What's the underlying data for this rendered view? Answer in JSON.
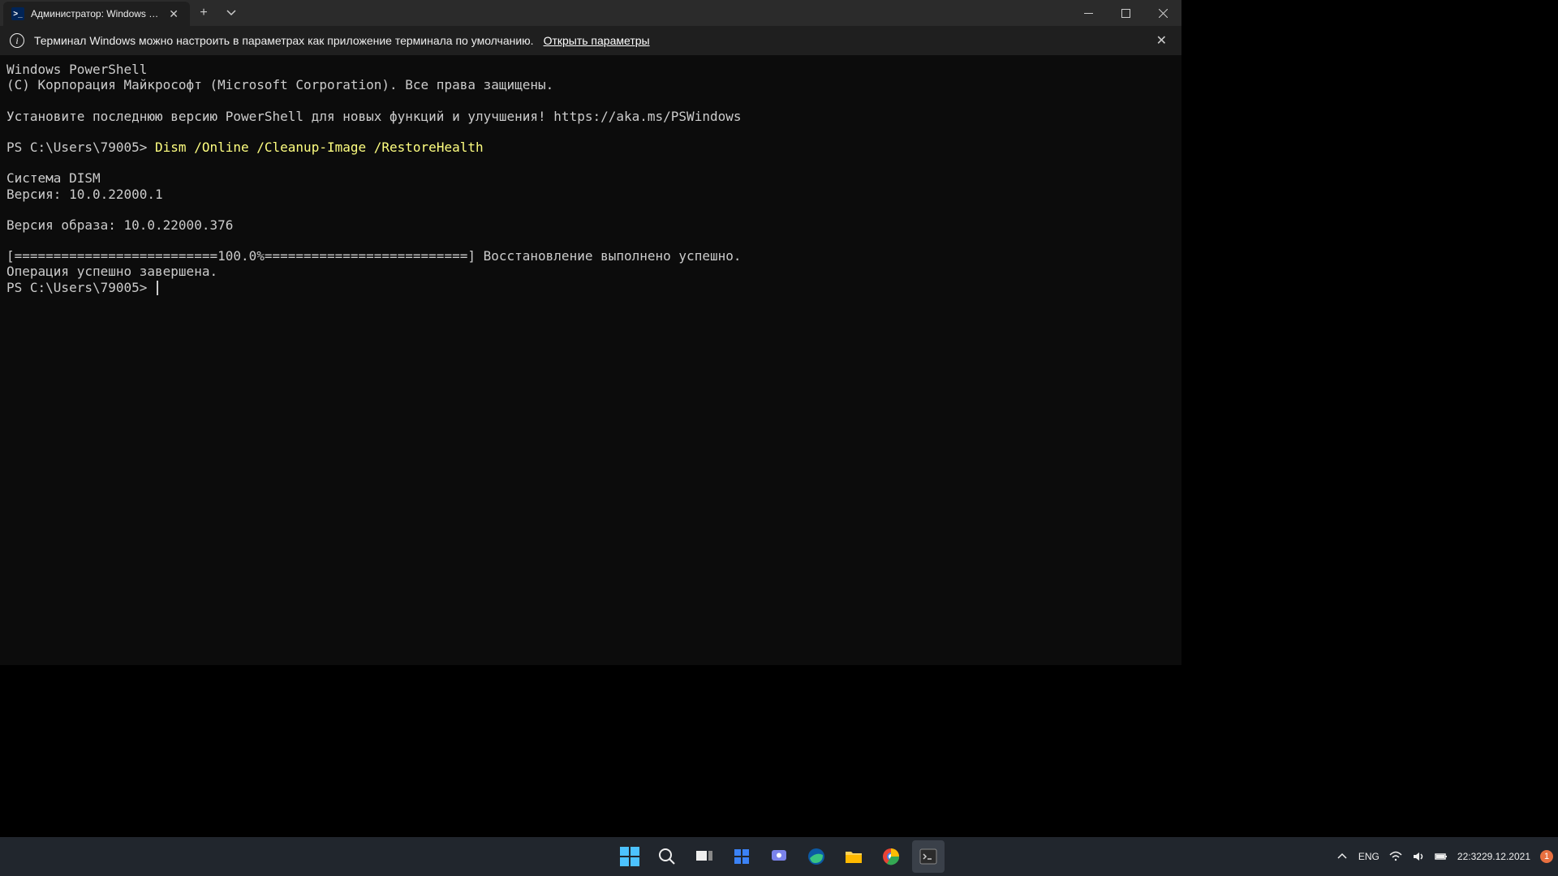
{
  "window": {
    "tab_title": "Администратор: Windows Pow",
    "tab_icon_label": ">_"
  },
  "infobar": {
    "message": "Терминал Windows можно настроить в параметрах как приложение терминала по умолчанию.",
    "link": "Открыть параметры"
  },
  "terminal": {
    "lines": [
      "Windows PowerShell",
      "(C) Корпорация Майкрософт (Microsoft Corporation). Все права защищены.",
      "",
      "Установите последнюю версию PowerShell для новых функций и улучшения! https://aka.ms/PSWindows",
      ""
    ],
    "prompt1_prefix": "PS C:\\Users\\79005> ",
    "prompt1_cmd": "Dism /Online /Cleanup-Image /RestoreHealth",
    "lines2": [
      "",
      "Cистема DISM",
      "Версия: 10.0.22000.1",
      "",
      "Версия образа: 10.0.22000.376",
      "",
      "[==========================100.0%==========================] Восстановление выполнено успешно.",
      "Операция успешно завершена."
    ],
    "prompt2": "PS C:\\Users\\79005> "
  },
  "tray": {
    "lang": "ENG",
    "time": "22:32",
    "date": "29.12.2021",
    "notif_count": "1"
  }
}
